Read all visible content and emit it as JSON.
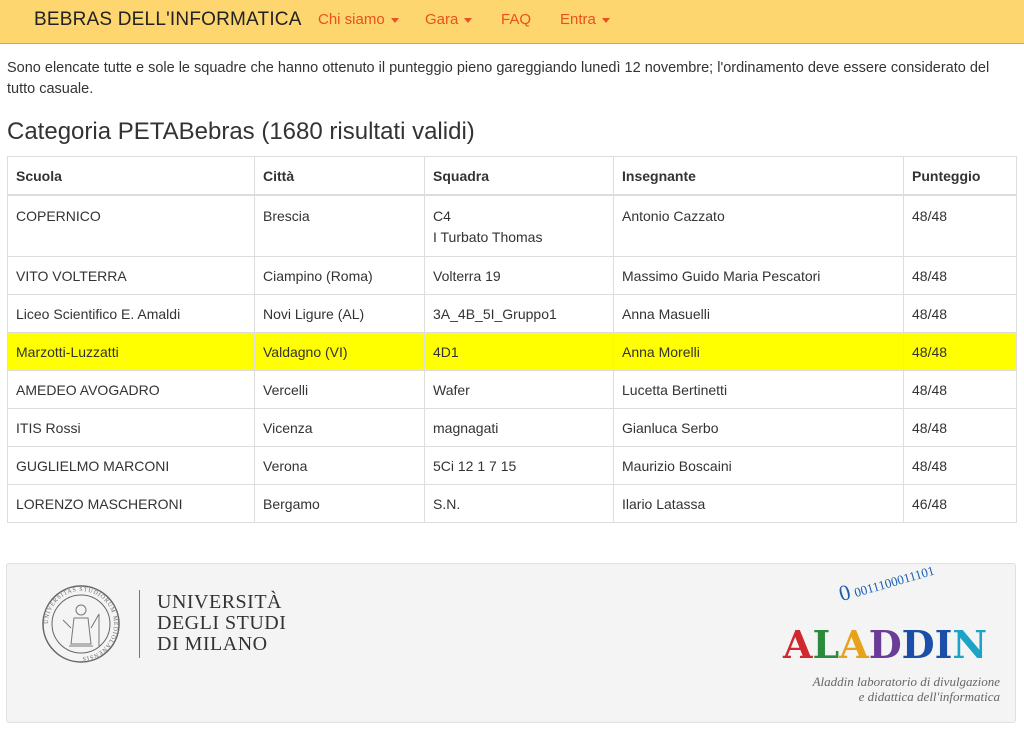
{
  "navbar": {
    "brand": "BEBRAS DELL'INFORMATICA",
    "items": [
      {
        "label": "Chi siamo",
        "dropdown": true
      },
      {
        "label": "Gara",
        "dropdown": true
      },
      {
        "label": "FAQ",
        "dropdown": false
      },
      {
        "label": "Entra",
        "dropdown": true
      }
    ]
  },
  "intro": "Sono elencate tutte e sole le squadre che hanno ottenuto il punteggio pieno gareggiando lunedì 12 novembre; l'ordinamento deve essere considerato del tutto casuale.",
  "category_title": "Categoria PETABebras (1680 risultati validi)",
  "table": {
    "headers": [
      "Scuola",
      "Città",
      "Squadra",
      "Insegnante",
      "Punteggio"
    ],
    "rows": [
      {
        "scuola": "COPERNICO",
        "citta": "Brescia",
        "squadra": "C4",
        "squadra_line2": "I Turbato Thomas",
        "insegnante": "Antonio Cazzato",
        "punteggio": "48/48"
      },
      {
        "scuola": "VITO VOLTERRA",
        "citta": "Ciampino (Roma)",
        "squadra": "Volterra 19",
        "insegnante": "Massimo Guido Maria Pescatori",
        "punteggio": "48/48"
      },
      {
        "scuola": "Liceo Scientifico E. Amaldi",
        "citta": "Novi Ligure (AL)",
        "squadra": "3A_4B_5I_Gruppo1",
        "insegnante": "Anna Masuelli",
        "punteggio": "48/48"
      },
      {
        "scuola": "Marzotti-Luzzatti",
        "citta": "Valdagno (VI)",
        "squadra": "4D1",
        "insegnante": "Anna Morelli",
        "punteggio": "48/48",
        "highlighted": true
      },
      {
        "scuola": "AMEDEO AVOGADRO",
        "citta": "Vercelli",
        "squadra": "Wafer",
        "insegnante": "Lucetta Bertinetti",
        "punteggio": "48/48"
      },
      {
        "scuola": "ITIS Rossi",
        "citta": "Vicenza",
        "squadra": "magnagati",
        "insegnante": "Gianluca Serbo",
        "punteggio": "48/48"
      },
      {
        "scuola": "GUGLIELMO MARCONI",
        "citta": "Verona",
        "squadra": "5Ci 12 1 7 15",
        "insegnante": "Maurizio Boscaini",
        "punteggio": "48/48"
      },
      {
        "scuola": "LORENZO MASCHERONI",
        "citta": "Bergamo",
        "squadra": "S.N.",
        "insegnante": "Ilario Latassa",
        "punteggio": "46/48"
      }
    ],
    "highlight_color": "#ffff00"
  },
  "footer": {
    "university": [
      "UNIVERSITÀ",
      "DEGLI STUDI",
      "DI MILANO"
    ],
    "seal_text": "UNIVERSITAS STUDIORUM MEDIOLANENSIS",
    "aladdin_binary_lead": "0",
    "aladdin_binary": "0011100011101",
    "aladdin_letters": [
      {
        "char": "A",
        "color": "#d0282e"
      },
      {
        "char": "L",
        "color": "#2a8a3e"
      },
      {
        "char": "A",
        "color": "#e8a21a"
      },
      {
        "char": "D",
        "color": "#6a3c97"
      },
      {
        "char": "D",
        "color": "#1a4ea8"
      },
      {
        "char": "I",
        "color": "#1a4ea8"
      },
      {
        "char": "N",
        "color": "#1ba3c8"
      }
    ],
    "aladdin_tagline": [
      "Aladdin laboratorio di divulgazione",
      "e didattica dell'informatica"
    ]
  },
  "colors": {
    "navbar_bg": "#fed66f",
    "nav_link": "#e8511e"
  }
}
